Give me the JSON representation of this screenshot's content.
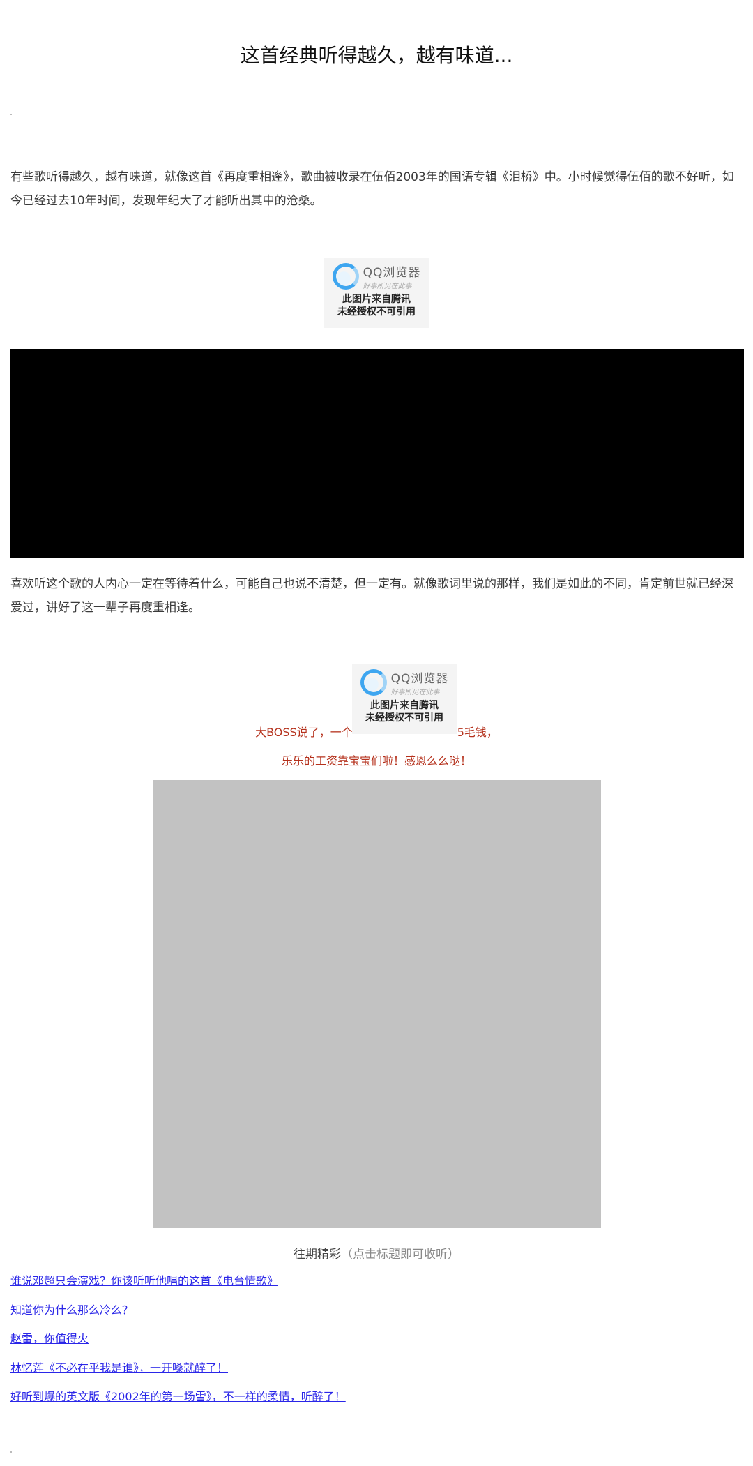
{
  "article": {
    "title": "这首经典听得越久，越有味道...",
    "paragraph1": "有些歌听得越久，越有味道，就像这首《再度重相逢》，歌曲被收录在伍佰2003年的国语专辑《泪桥》中。小时候觉得伍佰的歌不好听，如今已经过去10年时间，发现年纪大了才能听出其中的沧桑。",
    "paragraph2": "喜欢听这个歌的人内心一定在等待着什么，可能自己也说不清楚，但一定有。就像歌词里说的那样，我们是如此的不同，肯定前世就已经深爱过，讲好了这一辈子再度重相逢。"
  },
  "watermark": {
    "brand": "QQ浏览器",
    "slogan": "好事所见在此事",
    "line1": "此图片来自腾讯",
    "line2": "未经授权不可引用"
  },
  "promo": {
    "line1_before": "大BOSS说了，一个",
    "line1_after": "5毛钱，",
    "line2": "乐乐的工资靠宝宝们啦！感恩么么哒！"
  },
  "past": {
    "label": "往期精彩",
    "hint": "（点击标题即可收听）",
    "links": [
      "谁说邓超只会演戏？你该听听他唱的这首《电台情歌》",
      "知道你为什么那么冷么？",
      "赵雷，你值得火",
      "林忆莲《不必在乎我是谁》，一开嗓就醉了！",
      "好听到爆的英文版《2002年的第一场雪》，不一样的柔情，听醉了！"
    ]
  },
  "colors": {
    "link": "#2a26e8",
    "promo_red": "#b5311c",
    "video_bg": "#000000",
    "placeholder_gray": "#c2c2c2"
  }
}
